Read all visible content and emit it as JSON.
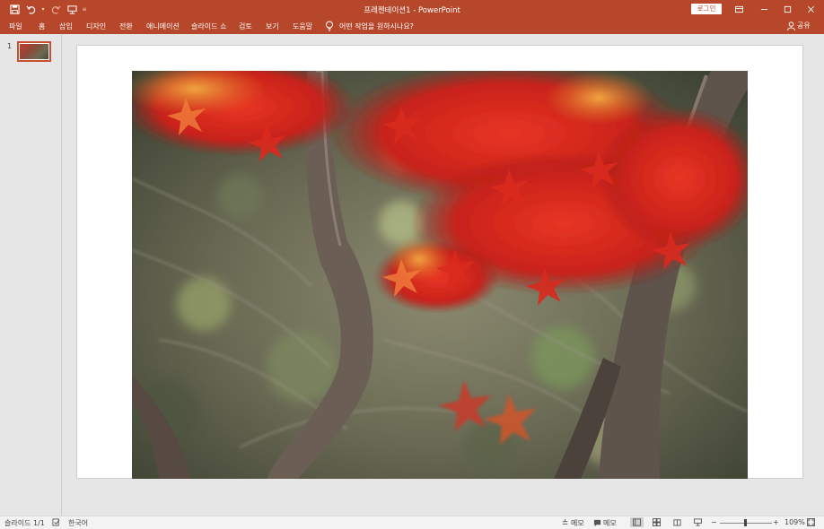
{
  "app": {
    "document_title": "프레젠테이션1  -  PowerPoint",
    "sign_in_label": "로그인",
    "accent_color": "#b7472a"
  },
  "ribbon": {
    "tabs": [
      "파일",
      "홈",
      "삽입",
      "디자인",
      "전환",
      "애니메이션",
      "슬라이드 쇼",
      "검토",
      "보기",
      "도움말"
    ],
    "tell_me": "어떤 작업을 원하시나요?",
    "share_label": "공유"
  },
  "thumbnails": [
    {
      "number": "1",
      "selected": true
    }
  ],
  "slide": {
    "image": "autumn red maple leaves over tree branches"
  },
  "status": {
    "slide_counter": "슬라이드 1/1",
    "language": "한국어",
    "notes_label": "메모",
    "comments_label": "메모",
    "zoom_level": "109%",
    "zoom_value": 1.09
  }
}
